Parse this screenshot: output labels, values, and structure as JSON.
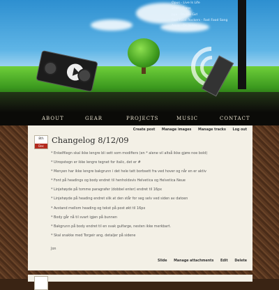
{
  "header": {
    "now_playing": [
      "Opus - Live Is Life",
      "2Pac - Trans",
      "Juju - Barbie Girl",
      "Fast Food Rockers - Fast Food Song",
      "Aqua - Dr. Jones"
    ]
  },
  "nav": {
    "items": [
      "About",
      "Gear",
      "Projects",
      "Music",
      "Contact"
    ]
  },
  "post": {
    "actions_top": [
      "Create post",
      "Manage images",
      "Manage tracks",
      "Log out"
    ],
    "date_day": "8th",
    "date_month": "Dec",
    "title": "Changelog 8/12/09",
    "lines": [
      "* Enkelfilegn skal ikke lengre bli sett som modifiers (en * alene vil altså ikke gjøre noe bold)",
      "* Utropstegn er ikke lengre tegnet for italic, det er #",
      "* Menyen har ikke lengre bakgrunn i det hele tatt borbsett fra ved hover og når en er aktiv",
      "* Font på headings og body endret til henholdsvis Helvetica og Helvetica Neue",
      "* Linjehøyde på tomme paragrafer (dobbel enter) endret til 16px",
      "* Linjehøyde på heading endret slik at den står for seg selv ved siden av datoen",
      "* Avstand mellom heading og tekst på post økt til 16px",
      "* Body går nå til svart igjen på bunnen",
      "* Bakgrunn på body endret til en svak gulfarge, nesten ikke merkbart.",
      "* Skal snakke med Torgeir ang. detaljer på sidene",
      "",
      "Jon"
    ],
    "actions_bottom": [
      "Slide",
      "Manage attachments",
      "Edit",
      "Delete"
    ]
  }
}
